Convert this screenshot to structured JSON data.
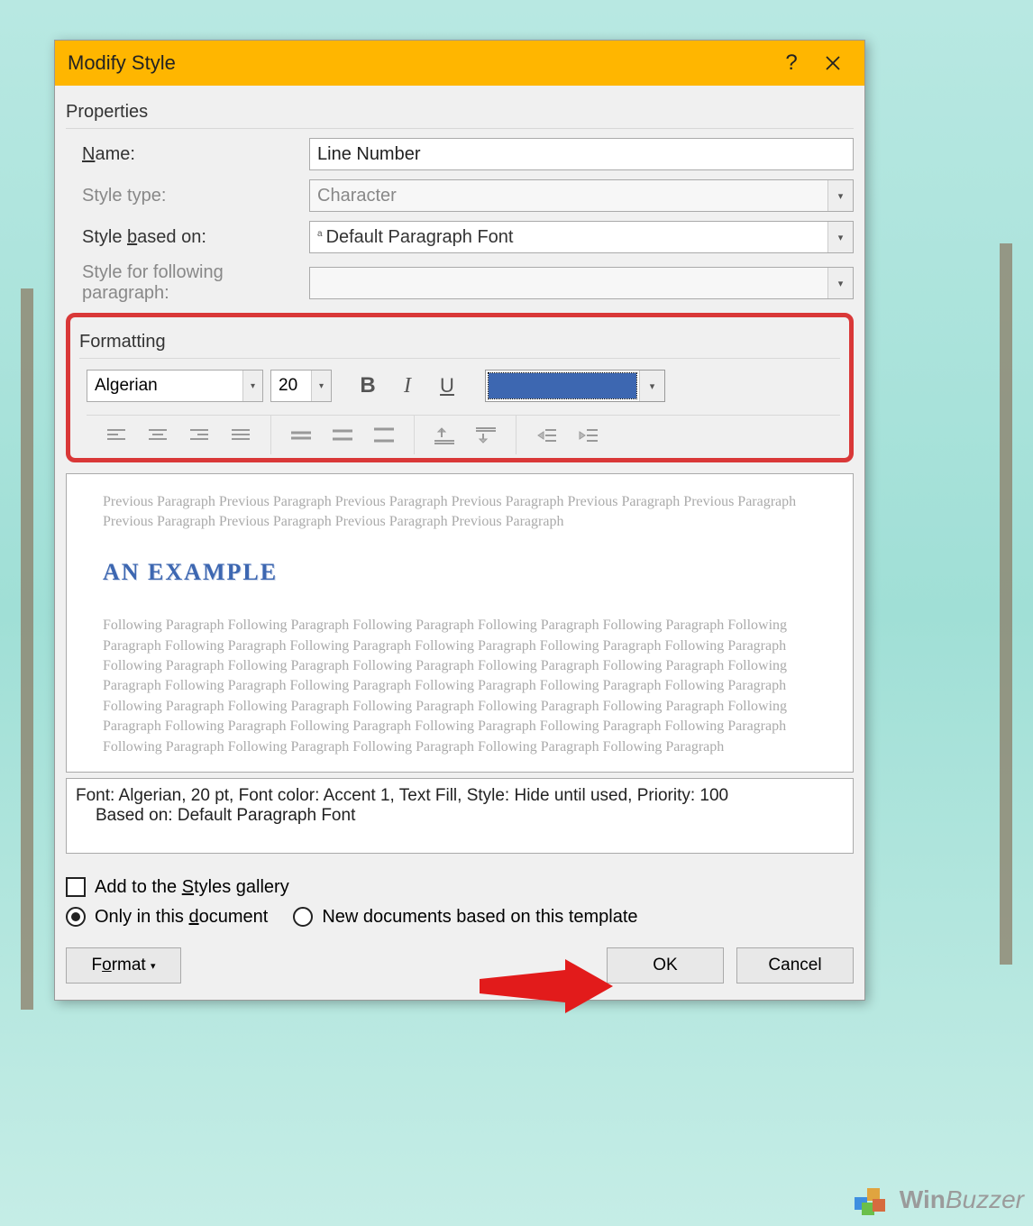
{
  "titlebar": {
    "title": "Modify Style"
  },
  "properties": {
    "section_label": "Properties",
    "name_label": "Name:",
    "name_value": "Line Number",
    "type_label": "Style type:",
    "type_value": "Character",
    "based_label": "Style based on:",
    "based_value": "Default Paragraph Font",
    "following_label": "Style for following paragraph:",
    "following_value": ""
  },
  "formatting": {
    "section_label": "Formatting",
    "font_name": "Algerian",
    "font_size": "20",
    "color_hex": "#3D67B1"
  },
  "preview": {
    "prev_text": "Previous Paragraph Previous Paragraph Previous Paragraph Previous Paragraph Previous Paragraph Previous Paragraph Previous Paragraph Previous Paragraph Previous Paragraph Previous Paragraph",
    "sample_text": "AN EXAMPLE",
    "follow_text": "Following Paragraph Following Paragraph Following Paragraph Following Paragraph Following Paragraph Following Paragraph Following Paragraph Following Paragraph Following Paragraph Following Paragraph Following Paragraph Following Paragraph Following Paragraph Following Paragraph Following Paragraph Following Paragraph Following Paragraph Following Paragraph Following Paragraph Following Paragraph Following Paragraph Following Paragraph Following Paragraph Following Paragraph Following Paragraph Following Paragraph Following Paragraph Following Paragraph Following Paragraph Following Paragraph Following Paragraph Following Paragraph Following Paragraph Following Paragraph Following Paragraph Following Paragraph Following Paragraph Following Paragraph"
  },
  "description": {
    "line1": "Font: Algerian, 20 pt, Font color: Accent 1, Text Fill, Style: Hide until used, Priority: 100",
    "line2": "Based on: Default Paragraph Font"
  },
  "options": {
    "add_gallery": "Add to the Styles gallery",
    "only_doc": "Only in this document",
    "new_docs": "New documents based on this template"
  },
  "buttons": {
    "format": "Format",
    "ok": "OK",
    "cancel": "Cancel"
  },
  "watermark": {
    "brand_bold": "Win",
    "brand_rest": "Buzzer"
  }
}
